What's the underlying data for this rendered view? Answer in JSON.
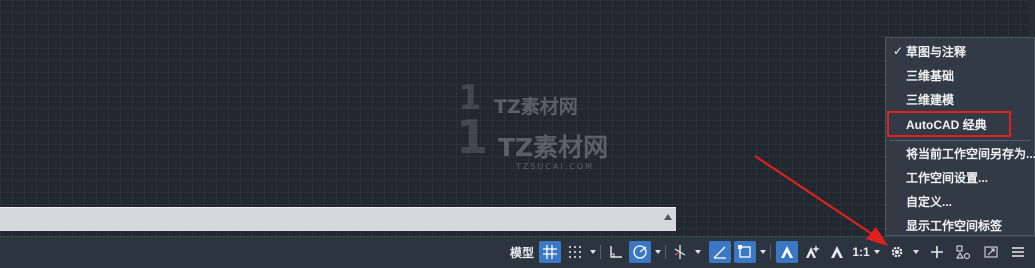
{
  "watermark": {
    "logo_glyph": "1",
    "small_text": "TZ素材网",
    "large_text": "TZ素材网",
    "large_sub": "TZSUCAI.COM"
  },
  "statusbar": {
    "model_label": "模型",
    "scale_label": "1:1"
  },
  "workspace_menu": {
    "items": [
      {
        "label": "草图与注释",
        "checked": true
      },
      {
        "label": "三维基础"
      },
      {
        "label": "三维建模"
      },
      {
        "label": "AutoCAD 经典"
      },
      {
        "label": "将当前工作空间另存为..."
      },
      {
        "label": "工作空间设置..."
      },
      {
        "label": "自定义..."
      },
      {
        "label": "显示工作空间标签"
      }
    ],
    "check_glyph": "✓"
  },
  "annotation": {
    "highlight_color": "#e02020",
    "arrow_color": "#e02020"
  },
  "colors": {
    "canvas_bg": "#212830",
    "statusbar_bg": "#2c3440",
    "active_blue": "#3b78c4"
  }
}
